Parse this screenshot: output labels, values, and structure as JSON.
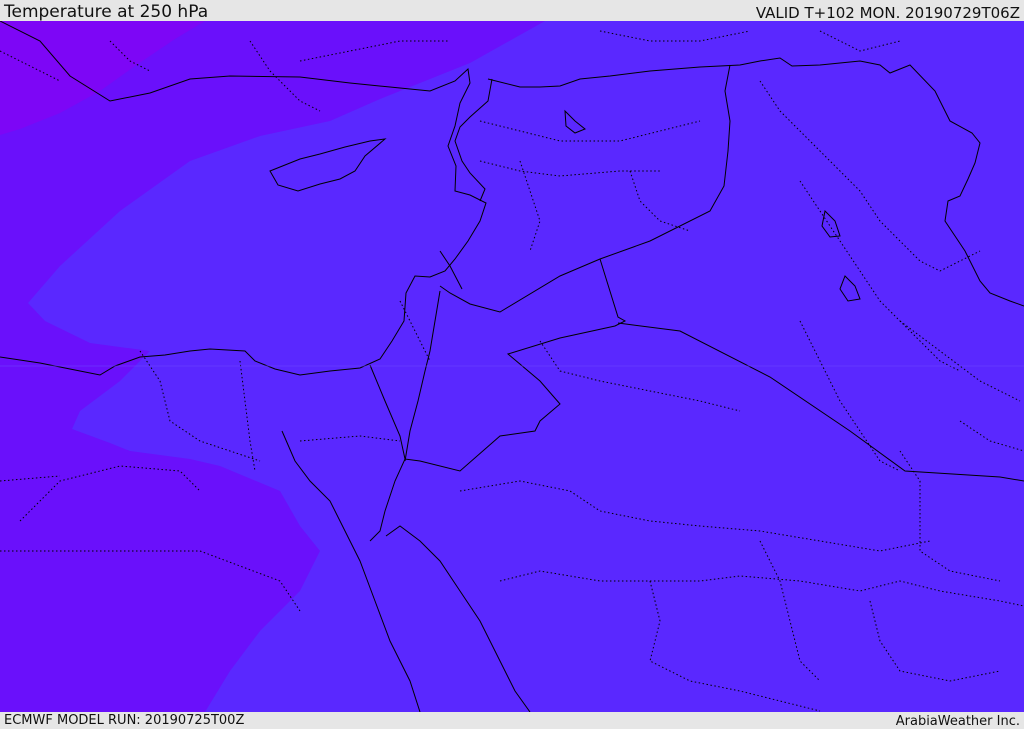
{
  "header": {
    "title": "Temperature at 250 hPa",
    "valid": "VALID T+102 MON. 20190729T06Z"
  },
  "footer": {
    "model_run": "ECMWF MODEL RUN: 20190725T00Z",
    "credit": "ArabiaWeather Inc."
  },
  "map": {
    "colors": {
      "warm_fill": "#5a28ff",
      "cold_fill": "#6a10fb",
      "coldest_fill": "#7d06f6",
      "boundary_line": "#000000"
    }
  }
}
